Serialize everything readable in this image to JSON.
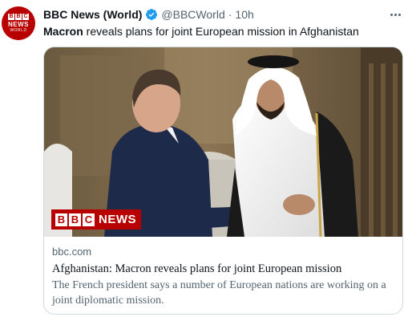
{
  "tweet": {
    "avatar": {
      "blocks": [
        "B",
        "B",
        "C"
      ],
      "line1": "NEWS",
      "line2": "WORLD"
    },
    "author": {
      "display_name": "BBC News (World)",
      "handle": "@BBCWorld",
      "separator": "·",
      "time": "10h",
      "verified": true
    },
    "text": {
      "bold": "Macron",
      "rest": " reveals plans for joint European mission in Afghanistan"
    },
    "card": {
      "image_alt": "Macron and Qatar's emir greeting each other",
      "badge": {
        "blocks": [
          "B",
          "B",
          "C"
        ],
        "label": "NEWS"
      },
      "domain": "bbc.com",
      "title": "Afghanistan: Macron reveals plans for joint European mission",
      "description": "The French president says a number of European nations are working on a joint diplomatic mission."
    },
    "more_icon": "more-horizontal-icon"
  },
  "colors": {
    "brand_red": "#b80000",
    "verified_blue": "#1d9bf0",
    "text_primary": "#0f1419",
    "text_secondary": "#536471",
    "border": "#cfd9de"
  }
}
